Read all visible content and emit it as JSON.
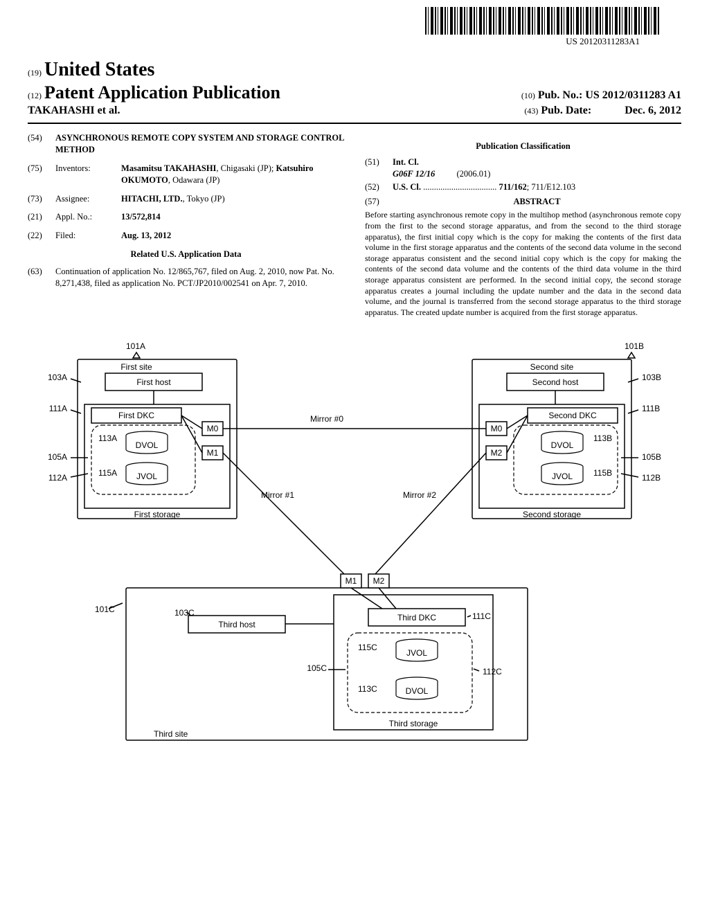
{
  "barcode_label": "US 20120311283A1",
  "header": {
    "f19": "(19)",
    "country": "United States",
    "f12": "(12)",
    "pub_type": "Patent Application Publication",
    "authors_line": "TAKAHASHI et al.",
    "f10": "(10)",
    "pub_no_label": "Pub. No.:",
    "pub_no": "US 2012/0311283 A1",
    "f43": "(43)",
    "pub_date_label": "Pub. Date:",
    "pub_date": "Dec. 6, 2012"
  },
  "left": {
    "title": {
      "code": "(54)",
      "text": "ASYNCHRONOUS REMOTE COPY SYSTEM AND STORAGE CONTROL METHOD"
    },
    "inventors": {
      "code": "(75)",
      "label": "Inventors:",
      "value_html": "Masamitsu TAKAHASHI, Chigasaki (JP); Katsuhiro OKUMOTO, Odawara (JP)",
      "v1": "Masamitsu TAKAHASHI",
      "v1_loc": ", Chigasaki (JP); ",
      "v2": "Katsuhiro OKUMOTO",
      "v2_loc": ", Odawara (JP)"
    },
    "assignee": {
      "code": "(73)",
      "label": "Assignee:",
      "value": "HITACHI, LTD.",
      "loc": ", Tokyo (JP)"
    },
    "appl_no": {
      "code": "(21)",
      "label": "Appl. No.:",
      "value": "13/572,814"
    },
    "filed": {
      "code": "(22)",
      "label": "Filed:",
      "value": "Aug. 13, 2012"
    },
    "related_title": "Related U.S. Application Data",
    "related": {
      "code": "(63)",
      "text": "Continuation of application No. 12/865,767, filed on Aug. 2, 2010, now Pat. No. 8,271,438, filed as application No. PCT/JP2010/002541 on Apr. 7, 2010."
    }
  },
  "right": {
    "class_title": "Publication Classification",
    "int_cl": {
      "code": "(51)",
      "label": "Int. Cl.",
      "cls": "G06F 12/16",
      "date": "(2006.01)"
    },
    "us_cl": {
      "code": "(52)",
      "label": "U.S. Cl.",
      "dots": " .................................. ",
      "value": "711/162",
      "extra": "; 711/E12.103"
    },
    "abstract_code": "(57)",
    "abstract_title": "ABSTRACT",
    "abstract_text": "Before starting asynchronous remote copy in the multihop method (asynchronous remote copy from the first to the second storage apparatus, and from the second to the third storage apparatus), the first initial copy which is the copy for making the contents of the first data volume in the first storage apparatus and the contents of the second data volume in the second storage apparatus consistent and the second initial copy which is the copy for making the contents of the second data volume and the contents of the third data volume in the third storage apparatus consistent are performed. In the second initial copy, the second storage apparatus creates a journal including the update number and the data in the second data volume, and the journal is transferred from the second storage apparatus to the third storage apparatus. The created update number is acquired from the first storage apparatus."
  },
  "diagram": {
    "site1": {
      "ref": "101A",
      "title": "First site",
      "host_ref": "103A",
      "host": "First host",
      "dkc_ref": "111A",
      "dkc": "First DKC",
      "storage": "First storage",
      "grp_ref": "112A",
      "dvol_ref": "113A",
      "jvol_ref": "115A",
      "jg_ref": "105A",
      "dvol": "DVOL",
      "jvol": "JVOL",
      "m0": "M0",
      "m1": "M1"
    },
    "site2": {
      "ref": "101B",
      "title": "Second site",
      "host_ref": "103B",
      "host": "Second host",
      "dkc_ref": "111B",
      "dkc": "Second DKC",
      "storage": "Second storage",
      "grp_ref": "112B",
      "dvol_ref": "113B",
      "jvol_ref": "115B",
      "jg_ref": "105B",
      "dvol": "DVOL",
      "jvol": "JVOL",
      "m0": "M0",
      "m2": "M2"
    },
    "site3": {
      "ref": "101C",
      "title": "Third site",
      "host_ref": "103C",
      "host": "Third host",
      "dkc_ref": "111C",
      "dkc": "Third DKC",
      "storage": "Third storage",
      "grp_ref": "112C",
      "dvol_ref": "113C",
      "jvol_ref": "115C",
      "jg_ref": "105C",
      "dvol": "DVOL",
      "jvol": "JVOL",
      "m1": "M1",
      "m2": "M2"
    },
    "mirrors": {
      "m0": "Mirror #0",
      "m1": "Mirror #1",
      "m2": "Mirror #2"
    }
  }
}
